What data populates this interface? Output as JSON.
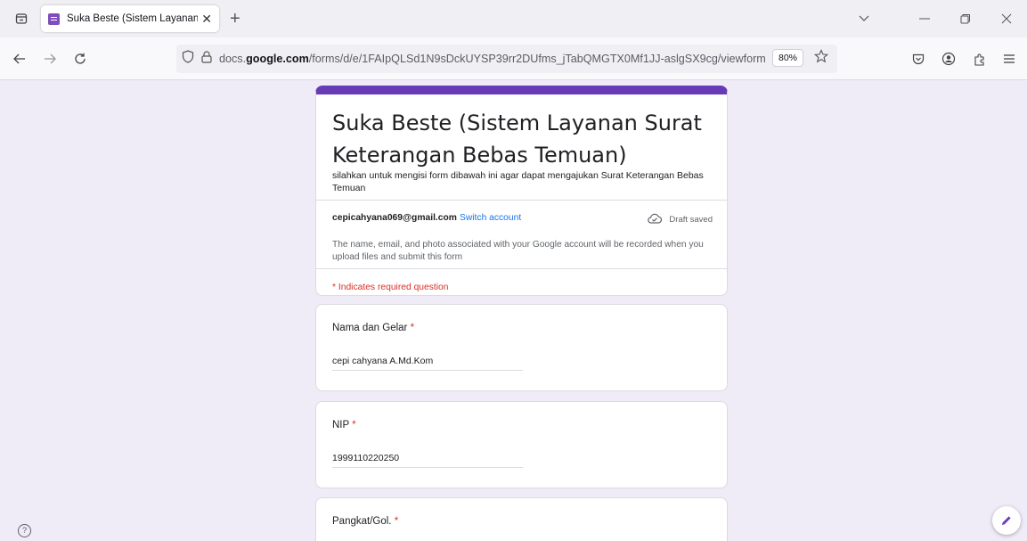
{
  "browser": {
    "tab": {
      "title": "Suka Beste (Sistem Layanan Sur",
      "close": "✕"
    },
    "new_tab": "+",
    "url": {
      "domain_pre": "docs.",
      "domain_bold": "google.com",
      "path": "/forms/d/e/1FAIpQLSd1N9sDckUYSP39rr2DUfms_jTabQMGTX0Mf1JJ-aslgSX9cg/viewform"
    },
    "zoom": "80%"
  },
  "form": {
    "title": "Suka Beste (Sistem Layanan Surat Keterangan Bebas Temuan)",
    "description": "silahkan untuk mengisi form dibawah ini agar dapat mengajukan Surat Keterangan Bebas Temuan",
    "account": {
      "email": "cepicahyana069@gmail.com",
      "switch_label": "Switch account",
      "draft_status": "Draft saved"
    },
    "record_note": "The name, email, and photo associated with your Google account will be recorded when you upload files and submit this form",
    "required_note": "* Indicates required question",
    "questions": [
      {
        "label": "Nama dan Gelar",
        "required_mark": "*",
        "answer": "cepi cahyana A.Md.Kom"
      },
      {
        "label": "NIP",
        "required_mark": "*",
        "answer": "1999110220250"
      },
      {
        "label": "Pangkat/Gol.",
        "required_mark": "*",
        "answer": ""
      }
    ]
  },
  "colors": {
    "accent": "#673ab7",
    "required": "#d93025",
    "link": "#1a73e8",
    "page_bg": "#efebf7"
  }
}
